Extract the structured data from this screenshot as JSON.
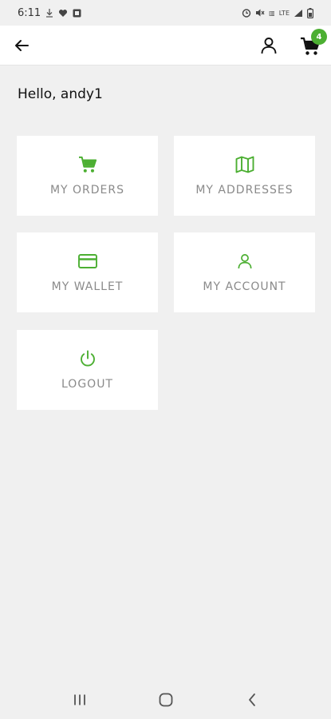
{
  "status_bar": {
    "time": "6:11",
    "network": "LTE"
  },
  "header": {
    "cart_count": "4"
  },
  "greeting": "Hello, andy1",
  "tiles": [
    {
      "label": "MY ORDERS",
      "icon": "cart-icon"
    },
    {
      "label": "MY ADDRESSES",
      "icon": "map-icon"
    },
    {
      "label": "MY WALLET",
      "icon": "credit-card-icon"
    },
    {
      "label": "MY ACCOUNT",
      "icon": "user-icon"
    },
    {
      "label": "LOGOUT",
      "icon": "power-icon"
    }
  ],
  "colors": {
    "accent": "#4caf32",
    "tile_label": "#8a8a8a",
    "background": "#f0f0f0"
  }
}
